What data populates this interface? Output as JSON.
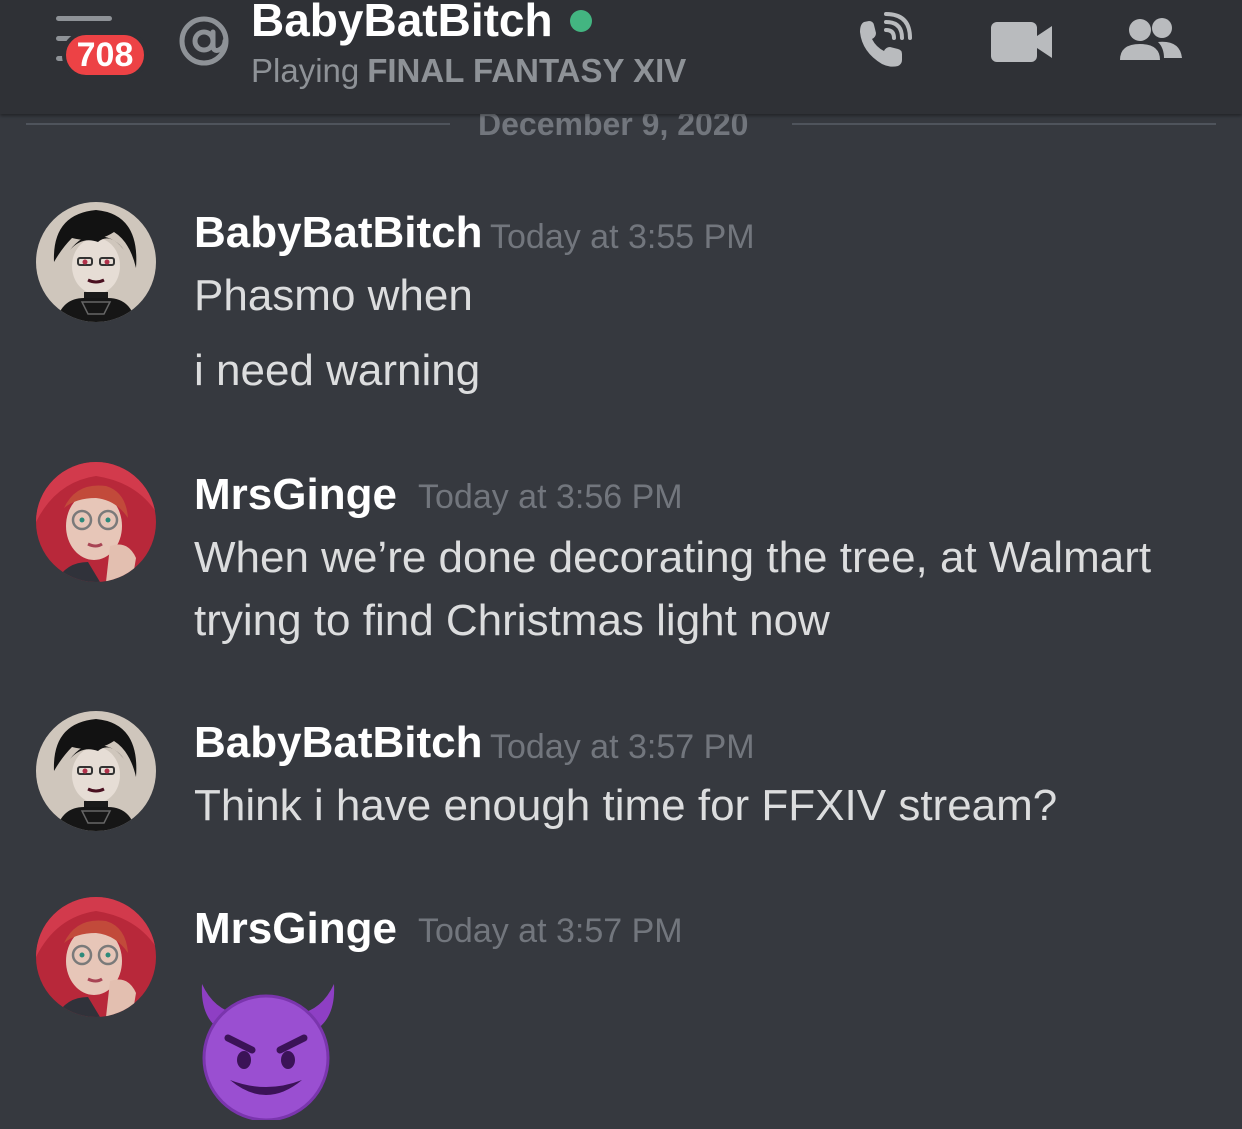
{
  "header": {
    "unread_badge": "708",
    "username": "BabyBatBitch",
    "activity_prefix": "Playing",
    "activity_game": "FINAL FANTASY XIV",
    "status_color": "#43b581",
    "icons": [
      "hamburger-menu-icon",
      "at-mention-icon",
      "voice-call-icon",
      "video-call-icon",
      "members-icon"
    ]
  },
  "date_divider": "December 9, 2020",
  "messages": [
    {
      "author": "BabyBatBitch",
      "timestamp": "Today at 3:55 PM",
      "lines": [
        "Phasmo when",
        "i need warning"
      ]
    },
    {
      "author": "MrsGinge",
      "timestamp": "Today at 3:56 PM",
      "lines": [
        "When we’re done decorating the tree, at Walmart",
        "trying to find Christmas light now"
      ]
    },
    {
      "author": "BabyBatBitch",
      "timestamp": "Today at 3:57 PM",
      "lines": [
        "Think i have enough time for FFXIV stream?"
      ]
    },
    {
      "author": "MrsGinge",
      "timestamp": "Today at 3:57 PM",
      "emoji": "smiling-imp-emoji"
    }
  ],
  "colors": {
    "background": "#36393f",
    "header_background": "#2f3136",
    "badge": "#ed4245",
    "emoji_purple": "#9a4fd1"
  }
}
